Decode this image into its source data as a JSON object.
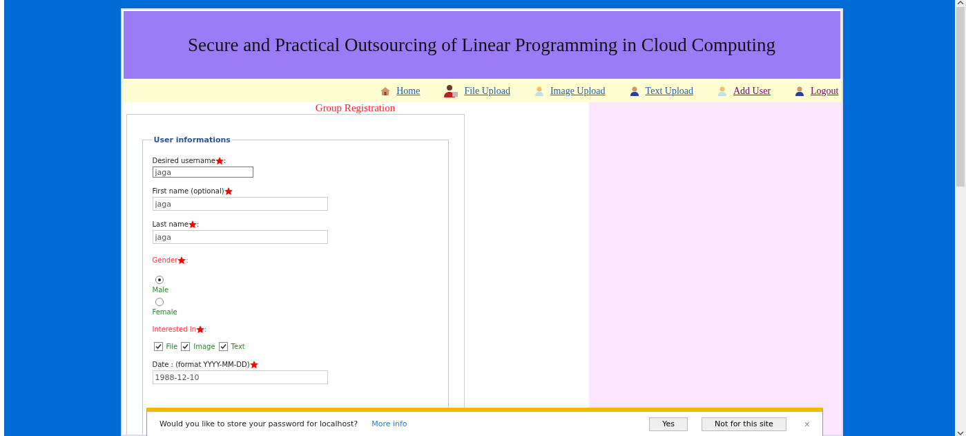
{
  "header": {
    "title": "Secure and Practical Outsourcing of Linear Programming in Cloud Computing"
  },
  "nav": [
    {
      "label": "Home",
      "visited": false
    },
    {
      "label": "File Upload",
      "visited": false
    },
    {
      "label": "Image Upload",
      "visited": false
    },
    {
      "label": "Text Upload",
      "visited": false
    },
    {
      "label": "Add User",
      "visited": true
    },
    {
      "label": "Logout",
      "visited": true
    }
  ],
  "form": {
    "heading": "Group Registration",
    "legend": "User informations",
    "fields": [
      {
        "kind": "text",
        "label": "Desired username",
        "suffix": " :",
        "value": "jaga",
        "short": true
      },
      {
        "kind": "text",
        "label": "First name (optional)",
        "value": "jaga",
        "short": false
      },
      {
        "kind": "text",
        "label": "Last name",
        "suffix": " :",
        "value": "jaga",
        "short": false
      },
      {
        "kind": "radio",
        "label": "Gender",
        "suffix": " :",
        "options": [
          {
            "label": "Male",
            "selected": true
          },
          {
            "label": "Female",
            "selected": false
          }
        ]
      },
      {
        "kind": "checkbox",
        "label": "Interested In",
        "suffix": " :",
        "options": [
          {
            "label": "File",
            "checked": true
          },
          {
            "label": "Image",
            "checked": true
          },
          {
            "label": "Text",
            "checked": true
          }
        ]
      },
      {
        "kind": "text",
        "label": "Date : (format YYYY-MM-DD)",
        "value": "1988-12-10",
        "short": false
      }
    ]
  },
  "password_bar": {
    "message": "Would you like to store your password for localhost?",
    "link": "More info",
    "buttons": [
      "Yes",
      "Not for this site"
    ],
    "close": "×"
  }
}
